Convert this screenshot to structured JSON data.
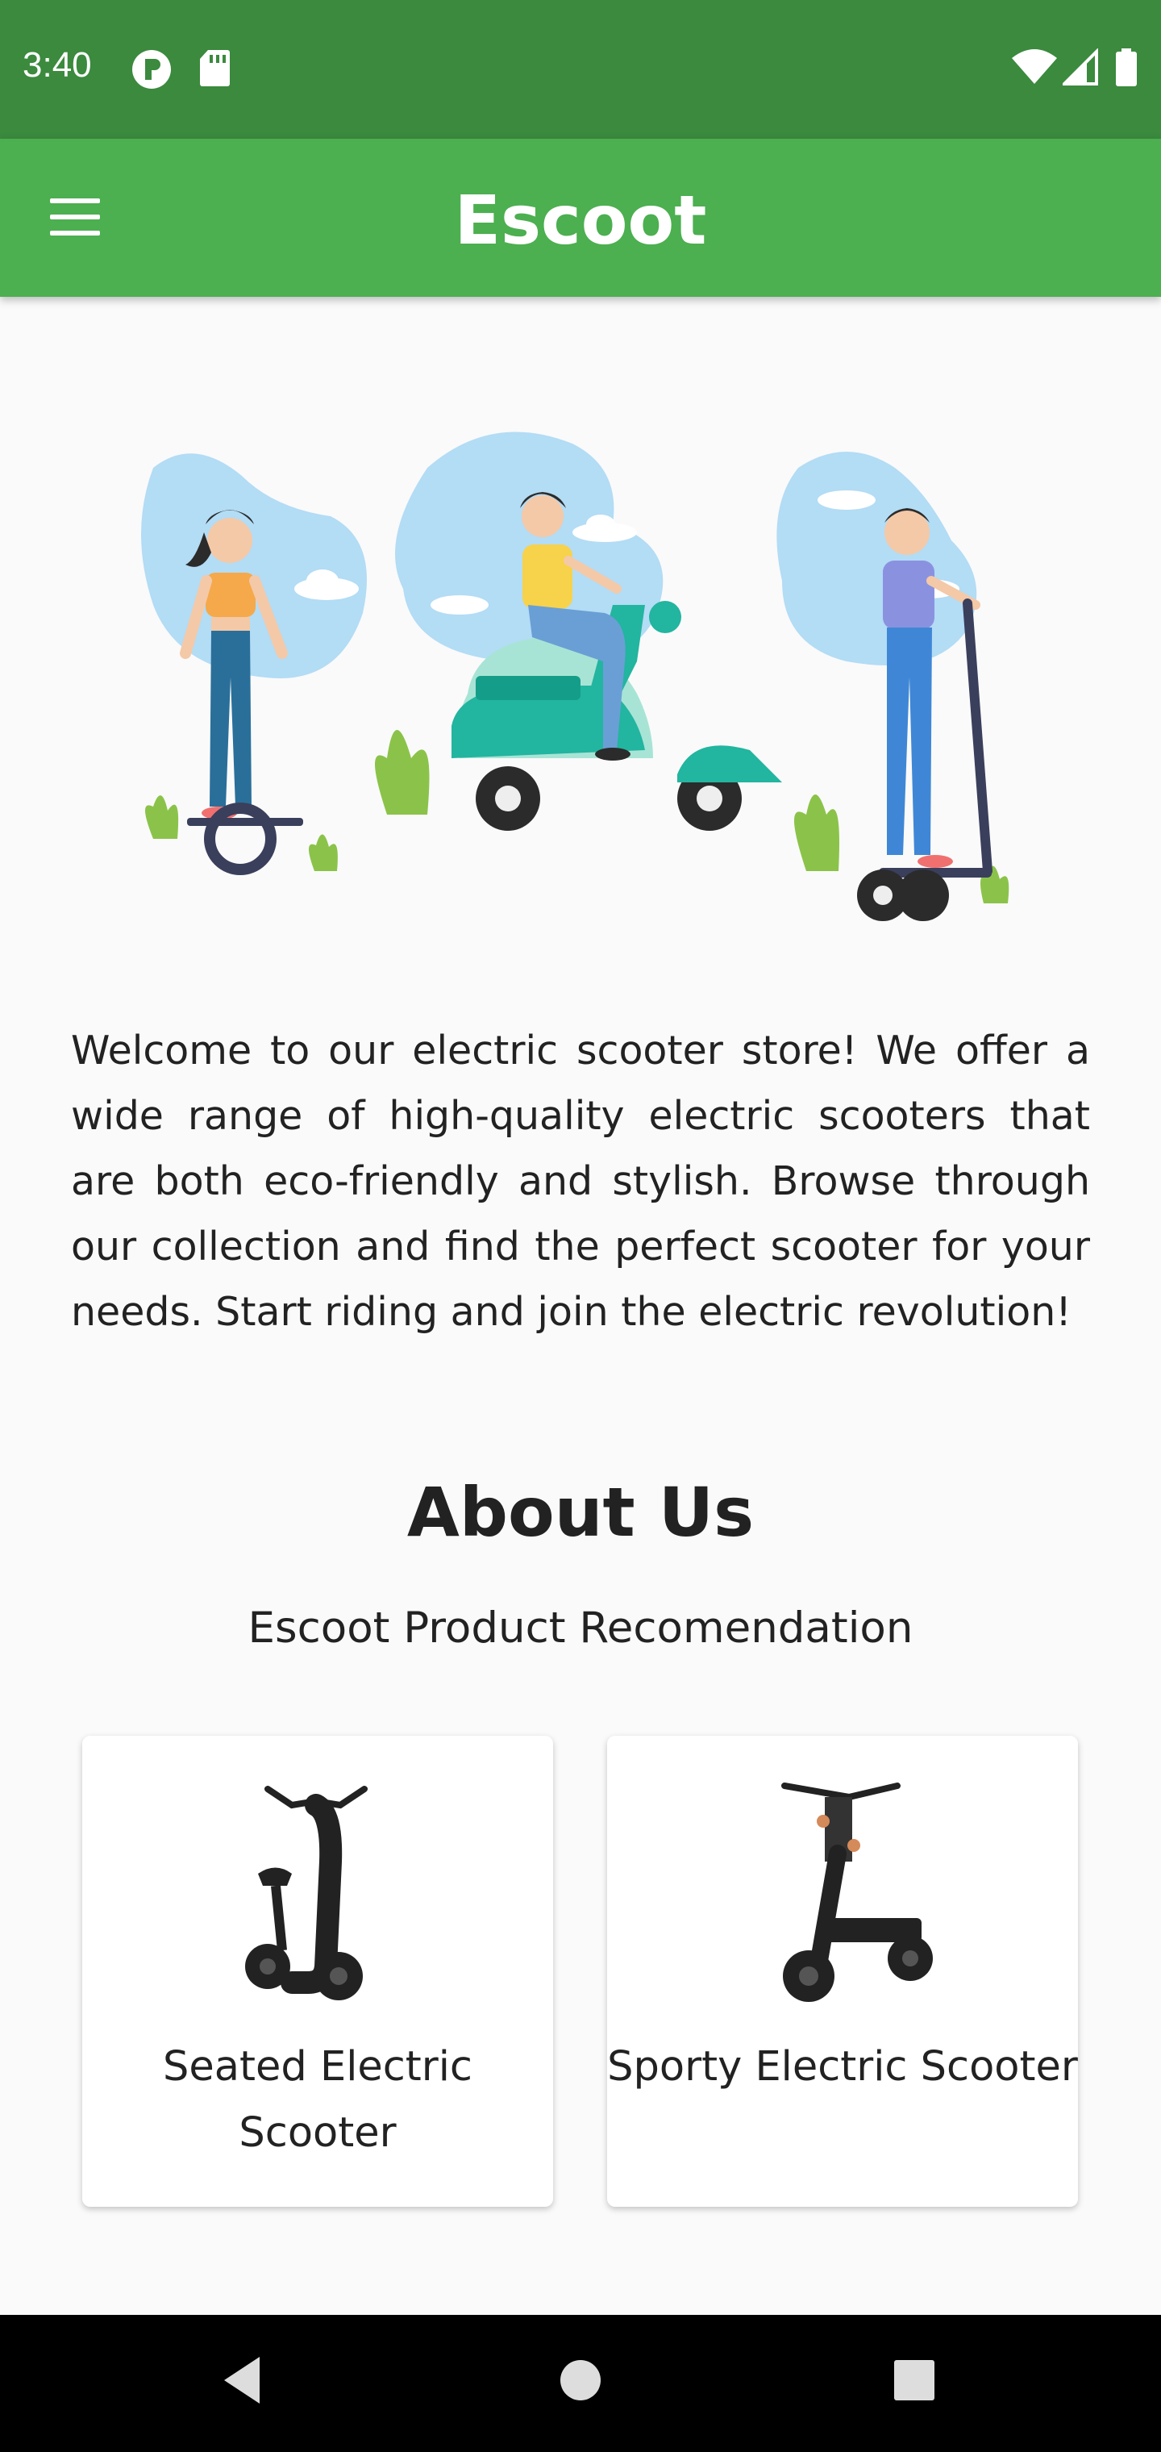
{
  "status_bar": {
    "time": "3:40"
  },
  "app_bar": {
    "title": "Escoot"
  },
  "welcome_text": " Welcome to our electric scooter store! We offer a wide range of high-quality electric scooters that are both eco-friendly and stylish. Browse through our collection and find the perfect scooter for your needs. Start riding and join the electric revolution!",
  "about": {
    "title": "About Us",
    "subtitle": "Escoot Product Recomendation"
  },
  "products": [
    {
      "label": "Seated Electric Scooter"
    },
    {
      "label": "Sporty Electric Scooter"
    }
  ],
  "colors": {
    "status_bar": "#3b8a3e",
    "app_bar": "#4caf50",
    "background": "#fafafa"
  },
  "icons": [
    "menu-icon",
    "back-icon",
    "home-icon",
    "recents-icon",
    "wifi-icon",
    "signal-icon",
    "battery-icon"
  ]
}
